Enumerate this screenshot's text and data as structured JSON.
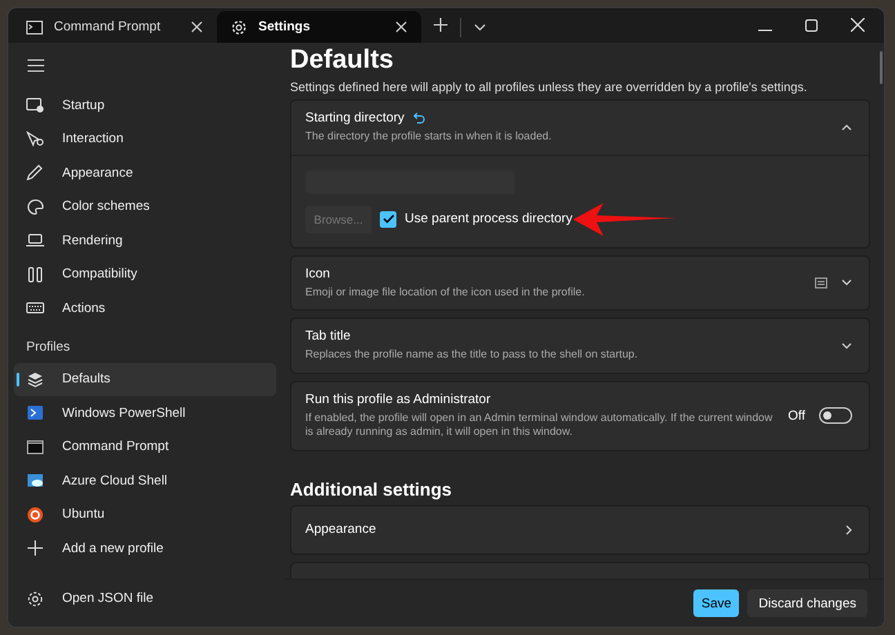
{
  "tabs": [
    {
      "label": "Command Prompt",
      "kind": "terminal",
      "selected": false
    },
    {
      "label": "Settings",
      "kind": "gear",
      "selected": true
    }
  ],
  "sidebar": {
    "items": [
      {
        "label": "Startup",
        "kind": "startup"
      },
      {
        "label": "Interaction",
        "kind": "interaction"
      },
      {
        "label": "Appearance",
        "kind": "pen"
      },
      {
        "label": "Color schemes",
        "kind": "palette"
      },
      {
        "label": "Rendering",
        "kind": "laptop"
      },
      {
        "label": "Compatibility",
        "kind": "tools"
      },
      {
        "label": "Actions",
        "kind": "keyboard"
      }
    ],
    "profiles_header": "Profiles",
    "profiles": [
      {
        "label": "Defaults",
        "kind": "layers",
        "selected": true
      },
      {
        "label": "Windows PowerShell",
        "kind": "powershell",
        "selected": false
      },
      {
        "label": "Command Prompt",
        "kind": "terminal",
        "selected": false
      },
      {
        "label": "Azure Cloud Shell",
        "kind": "cloud",
        "selected": false
      },
      {
        "label": "Ubuntu",
        "kind": "ubuntu",
        "selected": false
      },
      {
        "label": "Add a new profile",
        "kind": "plus",
        "selected": false
      }
    ],
    "footer_link": "Open JSON file"
  },
  "page": {
    "title": "Defaults",
    "description": "Settings defined here will apply to all profiles unless they are overridden by a profile's settings.",
    "settings": [
      {
        "kind": "directory",
        "title": "Starting directory",
        "description": "The directory the profile starts in when it is loaded.",
        "expanded": true,
        "browse": "Browse...",
        "browse_disabled": true,
        "checkbox": {
          "label": "Use parent process directory",
          "checked": true
        }
      },
      {
        "kind": "icon",
        "title": "Icon",
        "description": "Emoji or image file location of the icon used in the profile.",
        "expanded": false
      },
      {
        "kind": "text",
        "title": "Tab title",
        "description": "Replaces the profile name as the title to pass to the shell on startup.",
        "expanded": false
      },
      {
        "kind": "toggle",
        "title": "Run this profile as Administrator",
        "description": "If enabled, the profile will open in an Admin terminal window automatically. If the current window is already running as admin, it will open in this window.",
        "state_label": "Off",
        "on": false
      }
    ],
    "additional_header": "Additional settings",
    "additional": [
      {
        "label": "Appearance"
      }
    ]
  },
  "buttons": {
    "save": "Save",
    "discard": "Discard changes"
  }
}
